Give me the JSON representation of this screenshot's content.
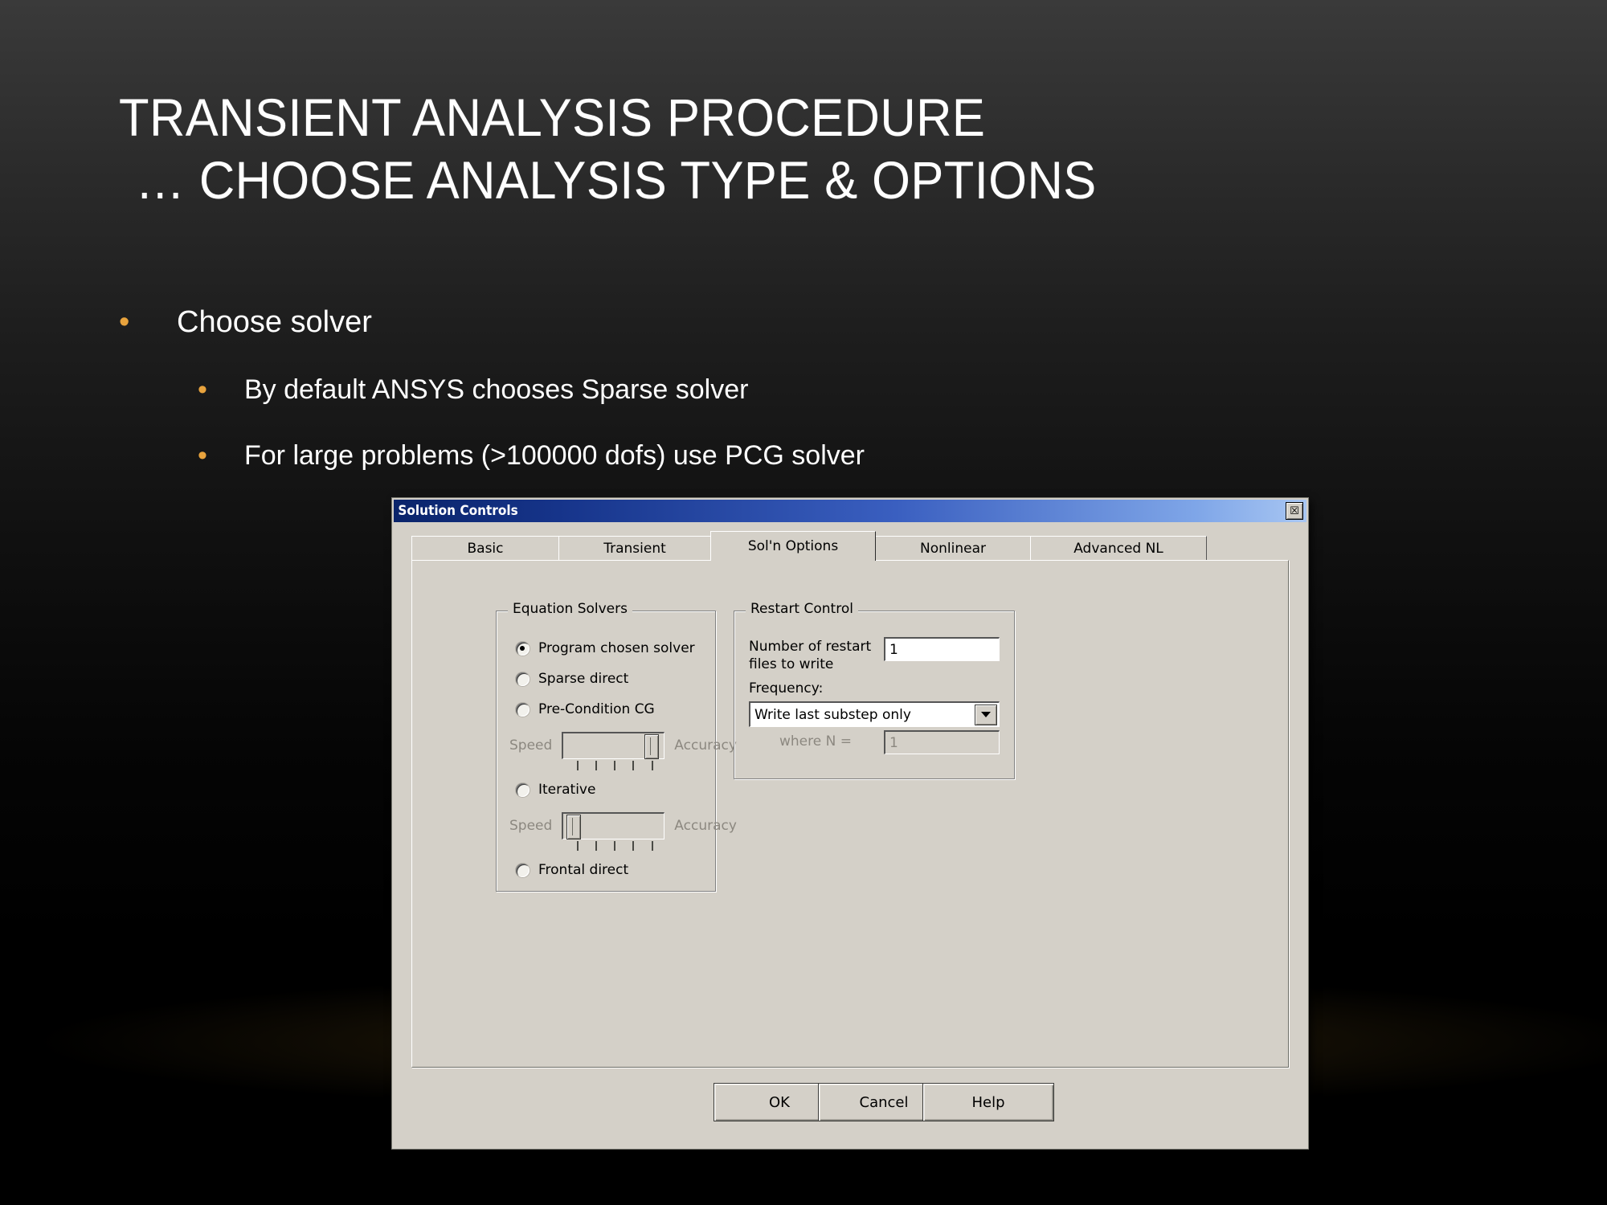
{
  "slide": {
    "title_line1": "TRANSIENT ANALYSIS PROCEDURE",
    "title_line2": "… CHOOSE ANALYSIS TYPE & OPTIONS",
    "bullet_char": "•",
    "bullet_color": "#e8a33d",
    "bullets": [
      {
        "level": 1,
        "text": "Choose solver"
      },
      {
        "level": 2,
        "text": "By default ANSYS chooses Sparse solver"
      },
      {
        "level": 2,
        "text": "For large problems (>100000 dofs) use PCG solver"
      }
    ]
  },
  "dialog": {
    "title": "Solution Controls",
    "close_glyph": "☒",
    "titlebar_color": "#0a246a",
    "face_color": "#d4d0c8",
    "tabs": [
      {
        "label": "Basic",
        "active": false
      },
      {
        "label": "Transient",
        "active": false
      },
      {
        "label": "Sol'n Options",
        "active": true
      },
      {
        "label": "Nonlinear",
        "active": false
      },
      {
        "label": "Advanced NL",
        "active": false
      }
    ],
    "equation_solvers": {
      "group_title": "Equation Solvers",
      "options": [
        {
          "label": "Program chosen solver",
          "selected": true
        },
        {
          "label": "Sparse direct",
          "selected": false
        },
        {
          "label": "Pre-Condition CG",
          "selected": false
        },
        {
          "label": "Iterative",
          "selected": false
        },
        {
          "label": "Frontal direct",
          "selected": false
        }
      ],
      "sliders": [
        {
          "left_label": "Speed",
          "right_label": "Accuracy",
          "value_pct": 92,
          "ticks": 5,
          "disabled": true
        },
        {
          "left_label": "Speed",
          "right_label": "Accuracy",
          "value_pct": 6,
          "ticks": 5,
          "disabled": true
        }
      ]
    },
    "restart_control": {
      "group_title": "Restart Control",
      "restart_files_label": "Number of restart files to write",
      "restart_files_value": "1",
      "frequency_label": "Frequency:",
      "frequency_value": "Write last substep only",
      "where_n_label": "where N =",
      "where_n_value": "1",
      "where_n_disabled": true
    },
    "buttons": [
      {
        "label": "OK"
      },
      {
        "label": "Cancel"
      },
      {
        "label": "Help"
      }
    ]
  }
}
